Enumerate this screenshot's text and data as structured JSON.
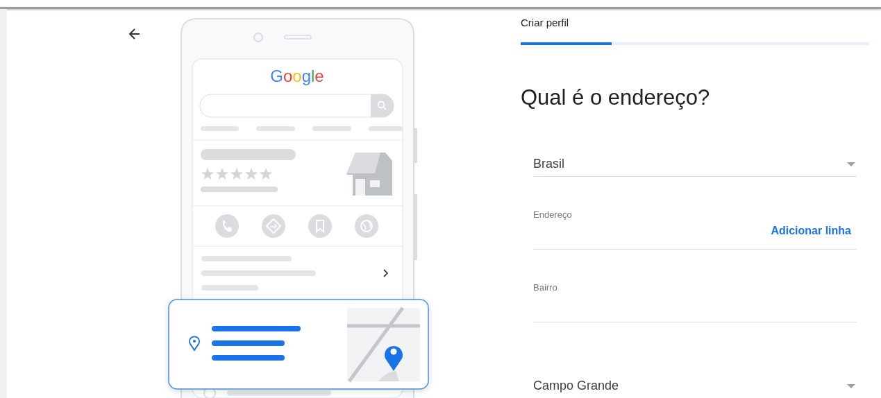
{
  "illustration": {
    "logo": "Google"
  },
  "progress": {
    "label": "Criar perfil",
    "level": 0.26
  },
  "heading": "Qual é o endereço?",
  "fields": [
    {
      "kind": "select",
      "value": "Brasil"
    },
    {
      "kind": "text",
      "label": "Endereço",
      "action": "Adicionar linha"
    },
    {
      "kind": "text",
      "label": "Bairro"
    },
    {
      "kind": "select",
      "value": "Campo Grande"
    }
  ]
}
